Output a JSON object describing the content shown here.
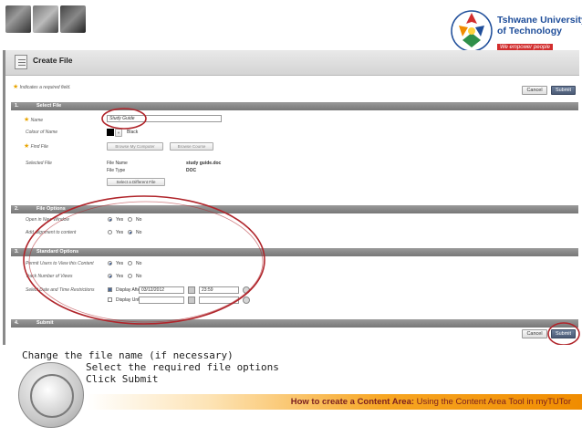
{
  "header": {
    "logo_line1": "Tshwane University",
    "logo_line2": "of Technology",
    "logo_tagline": "We empower people"
  },
  "screen": {
    "title": "Create File",
    "required_note": "Indicates a required field.",
    "cancel_label": "Cancel",
    "submit_label": "Submit",
    "sections": [
      {
        "num": "1.",
        "label": "Select File"
      },
      {
        "num": "2.",
        "label": "File Options"
      },
      {
        "num": "3.",
        "label": "Standard Options"
      },
      {
        "num": "4.",
        "label": "Submit"
      }
    ],
    "select_file": {
      "name_label": "Name",
      "name_value": "Study Guide",
      "colour_label": "Colour of Name",
      "colour_value": "Black",
      "find_label": "Find File",
      "browse_computer": "Browse My Computer",
      "browse_course": "Browse Course",
      "selected_label": "Selected File",
      "file_name_label": "File Name",
      "file_name_value": "study guide.doc",
      "file_type_label": "File Type",
      "file_type_value": "DOC",
      "different_file": "Select a Different File"
    },
    "file_options": {
      "open_label": "Open in New Window",
      "add_label": "Add alignment to content",
      "yes": "Yes",
      "no": "No"
    },
    "standard_options": {
      "permit_label": "Permit Users to View this Content",
      "track_label": "Track Number of Views",
      "select_label": "Select Date and Time Restrictions",
      "display_after": "Display After",
      "display_after_date": "03/12/2012",
      "display_after_time": "23:59",
      "display_until": "Display Until"
    }
  },
  "caption": {
    "line1": "Change the file name (if necessary)",
    "line2": "Select the required file options",
    "line3": "Click Submit"
  },
  "footer": {
    "bold": "How to create a Content Area:",
    "rest": " Using the Content Area Tool in myTUTor"
  },
  "colors": {
    "annotation": "#b0252b",
    "footer_accent": "#f08c00",
    "brand_blue": "#1f4e9a"
  }
}
